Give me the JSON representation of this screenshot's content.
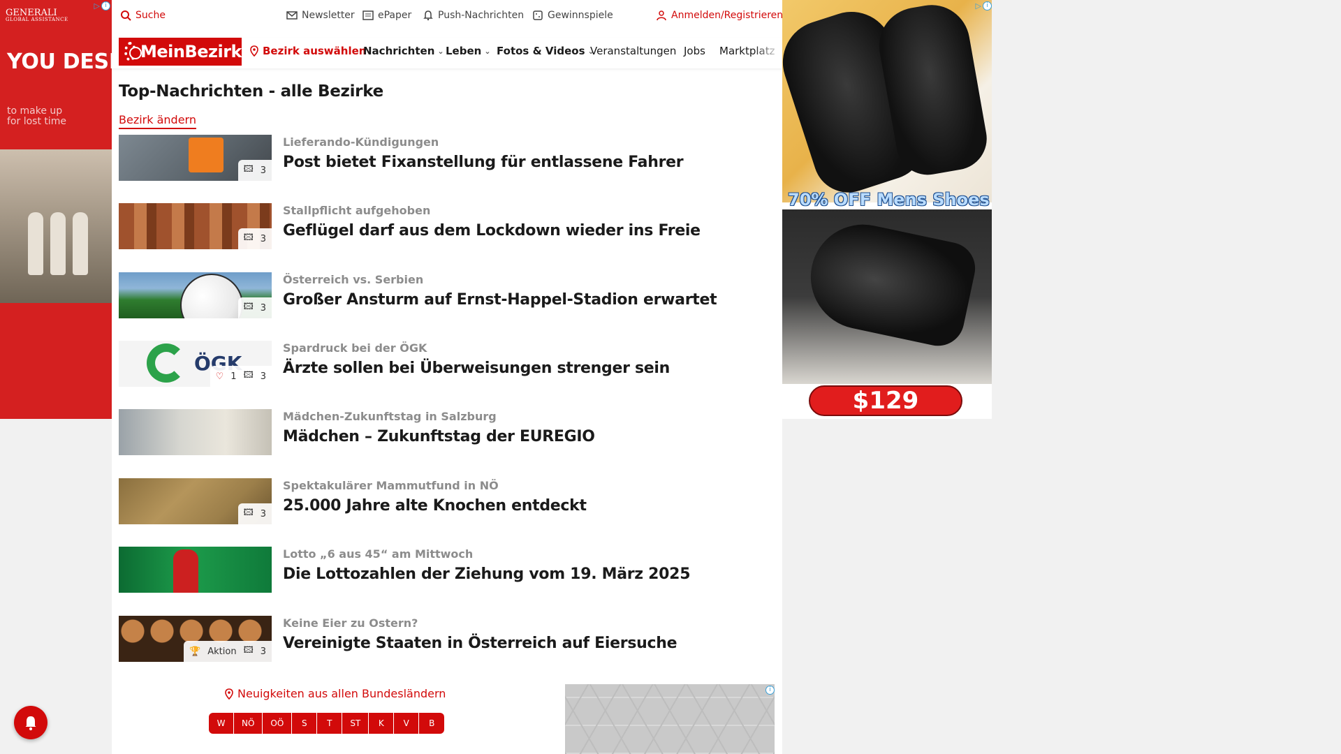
{
  "ads": {
    "left": {
      "brand": "GENERALI",
      "brand_sub": "GLOBAL ASSISTANCE",
      "headline": "YOU DESERV…",
      "sub": "to make up for lost time"
    },
    "right": {
      "promo": "70% OFF Mens Shoes",
      "price": "$129"
    }
  },
  "topbar": {
    "search": "Suche",
    "newsletter": "Newsletter",
    "epaper": "ePaper",
    "push": "Push-Nachrichten",
    "gewinnspiele": "Gewinnspiele",
    "login": "Anmelden/Registrieren"
  },
  "nav": {
    "logo": "MeinBezirk",
    "district": "Bezirk auswählen",
    "items": [
      "Nachrichten",
      "Leben",
      "Fotos & Videos",
      "Veranstaltungen",
      "Jobs",
      "Marktplatz"
    ]
  },
  "page": {
    "title": "Top-Nachrichten - alle Bezirke",
    "change_district": "Bezirk ändern"
  },
  "articles": [
    {
      "kicker": "Lieferando-Kündigungen",
      "headline": "Post bietet Fixanstellung für entlassene Fahrer",
      "images": "3"
    },
    {
      "kicker": "Stallpflicht aufgehoben",
      "headline": "Geflügel darf aus dem Lockdown wieder ins Freie",
      "images": "3"
    },
    {
      "kicker": "Österreich vs. Serbien",
      "headline": "Großer Ansturm auf Ernst-Happel-Stadion erwartet",
      "images": "3"
    },
    {
      "kicker": "Spardruck bei der ÖGK",
      "headline": "Ärzte sollen bei Überweisungen strenger sein",
      "images": "3",
      "likes": "1"
    },
    {
      "kicker": "Mädchen-Zukunftstag in Salzburg",
      "headline": "Mädchen – Zukunftstag der EUREGIO"
    },
    {
      "kicker": "Spektakulärer Mammutfund in NÖ",
      "headline": "25.000 Jahre alte Knochen entdeckt",
      "images": "3"
    },
    {
      "kicker": "Lotto „6 aus 45“ am Mittwoch",
      "headline": "Die Lottozahlen der Ziehung vom 19. März 2025"
    },
    {
      "kicker": "Keine Eier zu Ostern?",
      "headline": "Vereinigte Staaten in Österreich auf Eiersuche",
      "images": "3",
      "action": "Aktion"
    }
  ],
  "regions": {
    "title": "Neuigkeiten aus allen Bundesländern",
    "buttons": [
      "W",
      "NÖ",
      "OÖ",
      "S",
      "T",
      "ST",
      "K",
      "V",
      "B"
    ]
  },
  "colors": {
    "brand_red": "#d20a0a",
    "kicker_gray": "#8c8c8c"
  }
}
